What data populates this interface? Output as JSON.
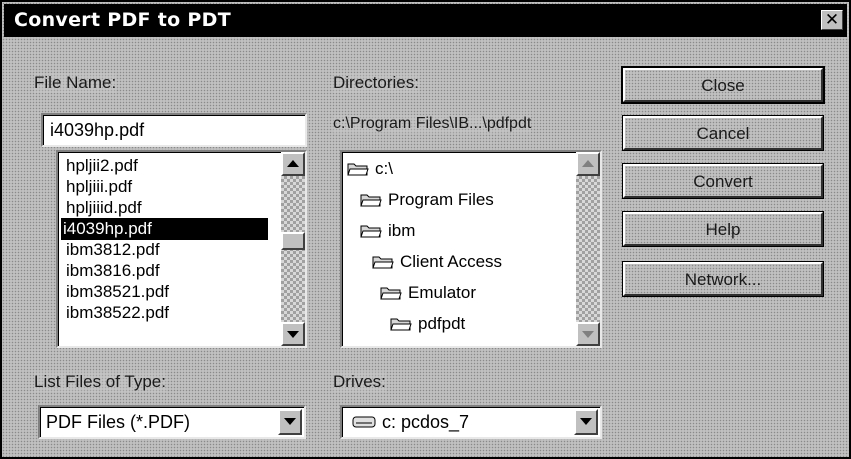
{
  "window": {
    "title": "Convert PDF to PDT",
    "close_glyph": "✕"
  },
  "file_name": {
    "label": "File Name:",
    "value": "i4039hp.pdf",
    "items": [
      "hpljii2.pdf",
      "hpljiii.pdf",
      "hpljiiid.pdf",
      "i4039hp.pdf",
      "ibm3812.pdf",
      "ibm3816.pdf",
      "ibm38521.pdf",
      "ibm38522.pdf"
    ],
    "selected_index": 3
  },
  "directories": {
    "label": "Directories:",
    "path": "c:\\Program Files\\IB...\\pdfpdt",
    "items": [
      "c:\\",
      "Program Files",
      "ibm",
      "Client Access",
      "Emulator",
      "pdfpdt"
    ]
  },
  "file_type": {
    "label": "List Files of Type:",
    "value": "PDF Files (*.PDF)"
  },
  "drives": {
    "label": "Drives:",
    "value": "c: pcdos_7",
    "icon": "drive-icon"
  },
  "buttons": {
    "close": "Close",
    "cancel": "Cancel",
    "convert": "Convert",
    "help": "Help",
    "network": "Network..."
  },
  "colors": {
    "titlebar": "#000000",
    "face": "#c0c0c0",
    "selection": "#000000"
  }
}
